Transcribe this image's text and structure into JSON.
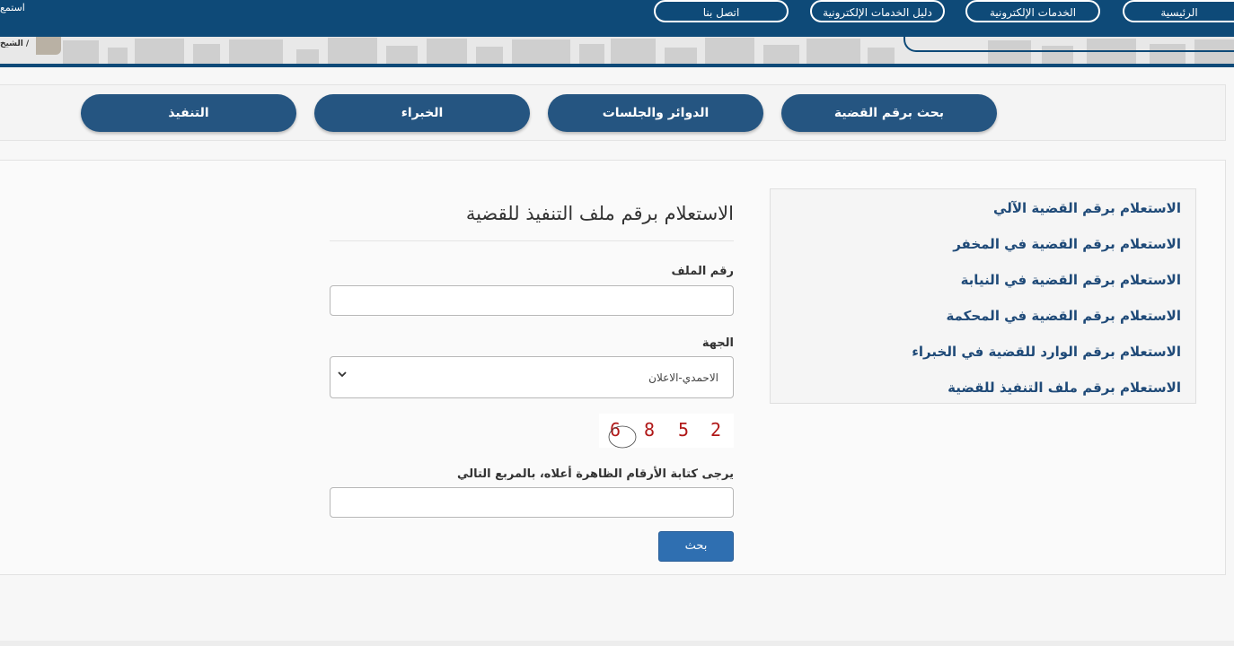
{
  "header": {
    "listen_label": "استمع",
    "nav": [
      {
        "label": "الرئيسية"
      },
      {
        "label": "الخدمات الإلكترونية"
      },
      {
        "label": "دليل الخدمات الإلكترونية"
      },
      {
        "label": "اتصل بنا"
      }
    ],
    "breadcrumb_text": "الشيخ /"
  },
  "tabs": [
    {
      "label": "بحث برقم القضية"
    },
    {
      "label": "الدوائر والجلسات"
    },
    {
      "label": "الخبراء"
    },
    {
      "label": "التنفيذ"
    }
  ],
  "sidebar": {
    "links": [
      {
        "label": "الاستعلام برقم القضية الآلي"
      },
      {
        "label": "الاستعلام برقم القضية في المخفر"
      },
      {
        "label": "الاستعلام برقم القضية في النيابة"
      },
      {
        "label": "الاستعلام برقم القضية في المحكمة"
      },
      {
        "label": "الاستعلام برقم الوارد للقضية في الخبراء"
      },
      {
        "label": "الاستعلام برقم ملف التنفيذ للقضية"
      }
    ]
  },
  "form": {
    "title": "الاستعلام برقم ملف التنفيذ للقضية",
    "file_number_label": "رقم الملف",
    "file_number_value": "",
    "authority_label": "الجهة",
    "authority_selected": "الاحمدي-الاعلان",
    "captcha_digits": [
      "6",
      "8",
      "5",
      "2"
    ],
    "captcha_label": "يرجى كتابة الأرقام الظاهرة أعلاه، بالمربع التالي",
    "captcha_value": "",
    "submit_label": "بحث"
  },
  "colors": {
    "header_bg": "#0e4a78",
    "tab_bg": "#255581",
    "link": "#1f4a78",
    "button": "#2f6fb1",
    "captcha": "#b01818"
  }
}
